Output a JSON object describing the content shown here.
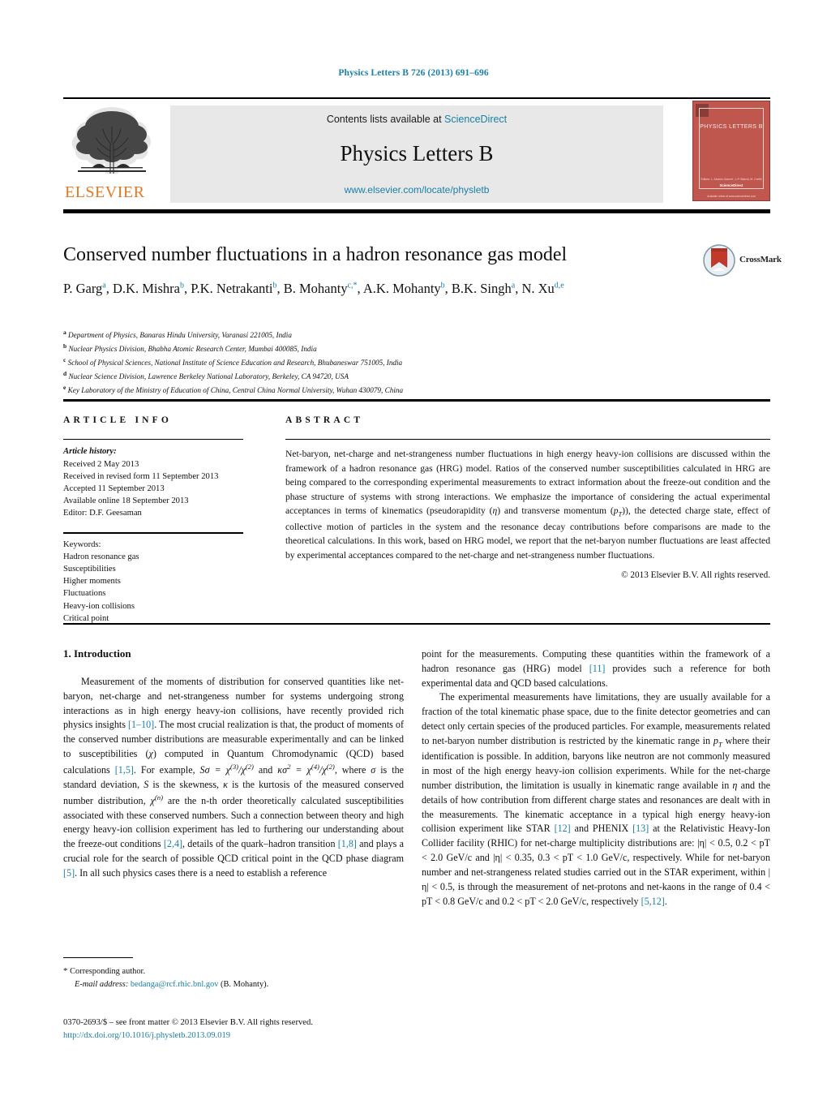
{
  "running_head": "Physics Letters B 726 (2013) 691–696",
  "masthead": {
    "contents_prefix": "Contents lists available at ",
    "contents_link": "ScienceDirect",
    "journal_title": "Physics Letters B",
    "journal_url": "www.elsevier.com/locate/physletb",
    "publisher_wordmark": "ELSEVIER",
    "cover": {
      "title": "PHYSICS LETTERS B",
      "foot1": "Editors: L. Alvarez-Gaumé, J.-P. Blaizot, M. Cvetič",
      "foot2": "ScienceDirect",
      "foot3": "Available online at www.sciencedirect.com"
    }
  },
  "article": {
    "title": "Conserved number fluctuations in a hadron resonance gas model",
    "crossmark_label": "CrossMark",
    "authors": [
      {
        "name": "P. Garg",
        "marks": "a",
        "sep": ", "
      },
      {
        "name": "D.K. Mishra",
        "marks": "b",
        "sep": ", "
      },
      {
        "name": "P.K. Netrakanti",
        "marks": "b",
        "sep": ", "
      },
      {
        "name": "B. Mohanty",
        "marks": "c,*",
        "sep": ", "
      },
      {
        "name": "A.K. Mohanty",
        "marks": "b",
        "sep": ", "
      },
      {
        "name": "B.K. Singh",
        "marks": "a",
        "sep": ", "
      },
      {
        "name": "N. Xu",
        "marks": "d,e",
        "sep": ""
      }
    ],
    "affiliations": [
      {
        "label": "a",
        "text": "Department of Physics, Banaras Hindu University, Varanasi 221005, India"
      },
      {
        "label": "b",
        "text": "Nuclear Physics Division, Bhabha Atomic Research Center, Mumbai 400085, India"
      },
      {
        "label": "c",
        "text": "School of Physical Sciences, National Institute of Science Education and Research, Bhubaneswar 751005, India"
      },
      {
        "label": "d",
        "text": "Nuclear Science Division, Lawrence Berkeley National Laboratory, Berkeley, CA 94720, USA"
      },
      {
        "label": "e",
        "text": "Key Laboratory of the Ministry of Education of China, Central China Normal University, Wuhan 430079, China"
      }
    ]
  },
  "article_info": {
    "heading": "ARTICLE INFO",
    "history_label": "Article history:",
    "history": [
      "Received 2 May 2013",
      "Received in revised form 11 September 2013",
      "Accepted 11 September 2013",
      "Available online 18 September 2013",
      "Editor: D.F. Geesaman"
    ],
    "keywords_label": "Keywords:",
    "keywords": [
      "Hadron resonance gas",
      "Susceptibilities",
      "Higher moments",
      "Fluctuations",
      "Heavy-ion collisions",
      "Critical point"
    ]
  },
  "abstract": {
    "heading": "ABSTRACT",
    "part1": "Net-baryon, net-charge and net-strangeness number fluctuations in high energy heavy-ion collisions are discussed within the framework of a hadron resonance gas (HRG) model. Ratios of the conserved number susceptibilities calculated in HRG are being compared to the corresponding experimental measurements to extract information about the freeze-out condition and the phase structure of systems with strong interactions. We emphasize the importance of considering the actual experimental acceptances in terms of kinematics (pseudorapidity (",
    "eta": "η",
    "part2": ") and transverse momentum (",
    "pt_p": "p",
    "pt_t": "T",
    "part3": ")), the detected charge state, effect of collective motion of particles in the system and the resonance decay contributions before comparisons are made to the theoretical calculations. In this work, based on HRG model, we report that the net-baryon number fluctuations are least affected by experimental acceptances compared to the net-charge and net-strangeness number fluctuations.",
    "copyright": "© 2013 Elsevier B.V. All rights reserved."
  },
  "body": {
    "section_number_title": "1. Introduction",
    "left_paragraph_1_a": "Measurement of the moments of distribution for conserved quantities like net-baryon, net-charge and net-strangeness number for systems undergoing strong interactions as in high energy heavy-ion collisions, have recently provided rich physics insights ",
    "cite_1_10": "[1–10]",
    "left_paragraph_1_b": ". The most crucial realization is that, the product of moments of the conserved number distributions are measurable experimentally and can be linked to susceptibilities (",
    "chi": "χ",
    "left_paragraph_1_c": ") computed in Quantum Chromodynamic (QCD) based calculations ",
    "cite_1_5": "[1,5]",
    "left_paragraph_1_d": ". For example, ",
    "formula_1": "Sσ = χ(3)/χ(2)",
    "left_paragraph_1_e": " and ",
    "formula_2": "κσ² = χ(4)/χ(2)",
    "left_paragraph_1_f": ", where ",
    "sigma": "σ",
    "left_paragraph_1_g": " is the standard deviation, ",
    "S": "S",
    "left_paragraph_1_h": " is the skewness, ",
    "kappa": "κ",
    "left_paragraph_1_i": " is the kurtosis of the measured conserved number distribution, ",
    "chi_n": "χ(n)",
    "left_paragraph_1_j": " are the n-th order theoretically calculated susceptibilities associated with these conserved numbers. Such a connection between theory and high energy heavy-ion collision experiment has led to furthering our understanding about the freeze-out conditions ",
    "cite_2_4": "[2,4]",
    "left_paragraph_1_k": ", details of the quark–hadron transition ",
    "cite_1_8": "[1,8]",
    "left_paragraph_1_l": " and plays a crucial role for the search of possible QCD critical point in the QCD phase diagram ",
    "cite_5": "[5]",
    "left_paragraph_1_m": ". In all such physics cases there is a need to establish a reference",
    "right_paragraph_1_a": "point for the measurements. Computing these quantities within the framework of a hadron resonance gas (HRG) model ",
    "cite_11": "[11]",
    "right_paragraph_1_b": " provides such a reference for both experimental data and QCD based calculations.",
    "right_paragraph_2_a": "The experimental measurements have limitations, they are usually available for a fraction of the total kinematic phase space, due to the finite detector geometries and can detect only certain species of the produced particles. For example, measurements related to net-baryon number distribution is restricted by the kinematic range in ",
    "pT": "pT",
    "right_paragraph_2_b": " where their identification is possible. In addition, baryons like neutron are not commonly measured in most of the high energy heavy-ion collision experiments. While for the net-charge number distribution, the limitation is usually in kinematic range available in ",
    "eta2": "η",
    "right_paragraph_2_c": " and the details of how contribution from different charge states and resonances are dealt with in the measurements. The kinematic acceptance in a typical high energy heavy-ion collision experiment like STAR ",
    "cite_12": "[12]",
    "right_paragraph_2_d": " and PHENIX ",
    "cite_13": "[13]",
    "right_paragraph_2_e": " at the Relativistic Heavy-Ion Collider facility (RHIC) for net-charge multiplicity distributions are: |η| < 0.5, 0.2 < pT < 2.0 GeV/c and |η| < 0.35, 0.3 < pT < 1.0 GeV/c, respectively. While for net-baryon number and net-strangeness related studies carried out in the STAR experiment, within |η| < 0.5, is through the measurement of net-protons and net-kaons in the range of 0.4 < pT < 0.8 GeV/c and 0.2 < pT < 2.0 GeV/c, respectively ",
    "cite_5_12": "[5,12]",
    "right_paragraph_2_f": "."
  },
  "footnote": {
    "star": "*",
    "corresponding": "Corresponding author.",
    "email_label": "E-mail address:",
    "email": "bedanga@rcf.rhic.bnl.gov",
    "email_owner": "(B. Mohanty)."
  },
  "imprint": {
    "line1": "0370-2693/$ – see front matter © 2013 Elsevier B.V. All rights reserved.",
    "doi": "http://dx.doi.org/10.1016/j.physletb.2013.09.019"
  },
  "colors": {
    "link": "#1a7fa8",
    "elsevier_orange": "#E87722",
    "cover_red": "#c0574f",
    "band_gray": "#e8e8e8"
  }
}
